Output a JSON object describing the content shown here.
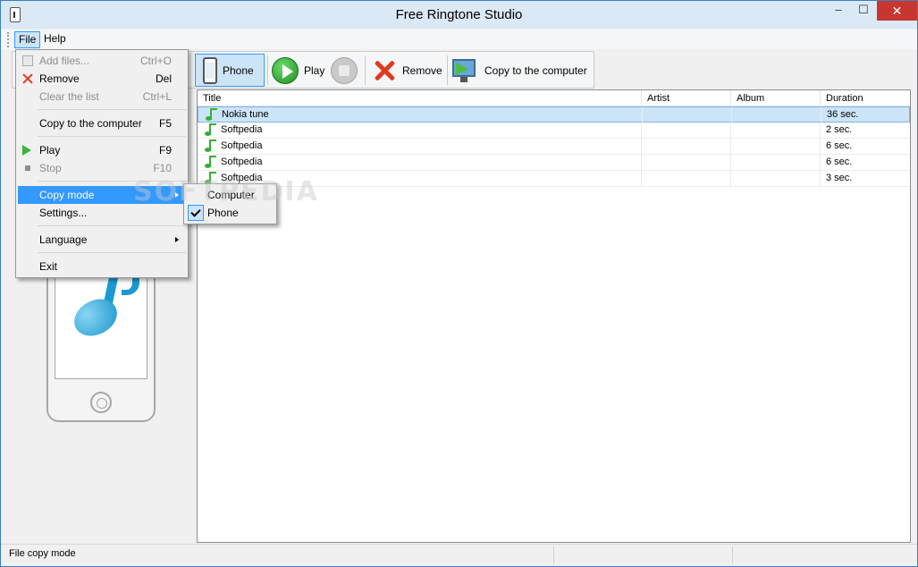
{
  "window": {
    "title": "Free Ringtone Studio",
    "controls": {
      "minimize": "–",
      "maximize": "☐",
      "close": "✕"
    }
  },
  "menubar": {
    "file": "File",
    "help": "Help"
  },
  "toolbar": {
    "phone": "Phone",
    "play": "Play",
    "remove": "Remove",
    "copy": "Copy to the computer"
  },
  "file_menu": {
    "items": [
      {
        "label": "Add files...",
        "shortcut": "Ctrl+O",
        "enabled": false,
        "icon": "add-files-icon"
      },
      {
        "label": "Remove",
        "shortcut": "Del",
        "enabled": true,
        "icon": "remove-icon"
      },
      {
        "label": "Clear the list",
        "shortcut": "Ctrl+L",
        "enabled": false
      },
      {
        "label": "Copy to the computer",
        "shortcut": "F5",
        "enabled": true
      },
      {
        "label": "Play",
        "shortcut": "F9",
        "enabled": true,
        "icon": "play-icon"
      },
      {
        "label": "Stop",
        "shortcut": "F10",
        "enabled": false,
        "icon": "stop-icon"
      },
      {
        "label": "Copy mode",
        "highlighted": true,
        "submenu": true
      },
      {
        "label": "Settings..."
      },
      {
        "label": "Language",
        "submenu": true
      },
      {
        "label": "Exit"
      }
    ]
  },
  "copy_mode_submenu": {
    "items": [
      {
        "label": "Computer",
        "checked": false
      },
      {
        "label": "Phone",
        "checked": true
      }
    ]
  },
  "list": {
    "columns": [
      "Title",
      "Artist",
      "Album",
      "Duration"
    ],
    "rows": [
      {
        "title": "Nokia tune",
        "artist": "",
        "album": "",
        "duration": "36 sec.",
        "selected": true
      },
      {
        "title": "Softpedia",
        "artist": "",
        "album": "",
        "duration": "2 sec.",
        "selected": false
      },
      {
        "title": "Softpedia",
        "artist": "",
        "album": "",
        "duration": "6 sec.",
        "selected": false
      },
      {
        "title": "Softpedia",
        "artist": "",
        "album": "",
        "duration": "6 sec.",
        "selected": false
      },
      {
        "title": "Softpedia",
        "artist": "",
        "album": "",
        "duration": "3 sec.",
        "selected": false
      }
    ]
  },
  "statusbar": {
    "text": "File copy mode"
  },
  "watermark": "SOFTPEDIA",
  "colors": {
    "highlight": "#3399ff",
    "selection": "#cce4f7",
    "close": "#c7372f"
  }
}
